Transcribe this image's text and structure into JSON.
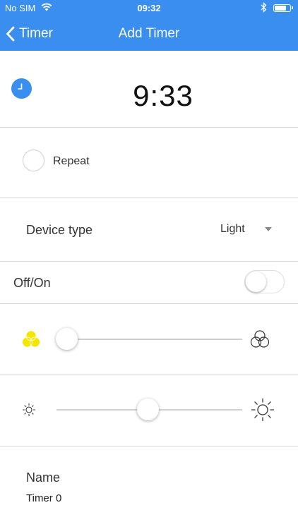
{
  "status_bar": {
    "carrier": "No SIM",
    "time": "09:32"
  },
  "nav": {
    "back_label": "Timer",
    "title": "Add Timer",
    "background_color": "#3a8ef0"
  },
  "timer": {
    "time": "9:33",
    "icon": "clock-icon"
  },
  "repeat": {
    "label": "Repeat",
    "checked": false
  },
  "device_type": {
    "label": "Device type",
    "value": "Light"
  },
  "power": {
    "label": "Off/On",
    "on": false
  },
  "color_slider": {
    "left_icon": "yellow-color-circles-icon",
    "right_icon": "rgb-color-circles-icon",
    "value_fraction": 0.0,
    "left_icon_color": "#f5e600"
  },
  "brightness_slider": {
    "left_icon": "brightness-low-icon",
    "right_icon": "brightness-high-icon",
    "value_fraction": 0.49
  },
  "name": {
    "label": "Name",
    "value": "Timer 0"
  }
}
